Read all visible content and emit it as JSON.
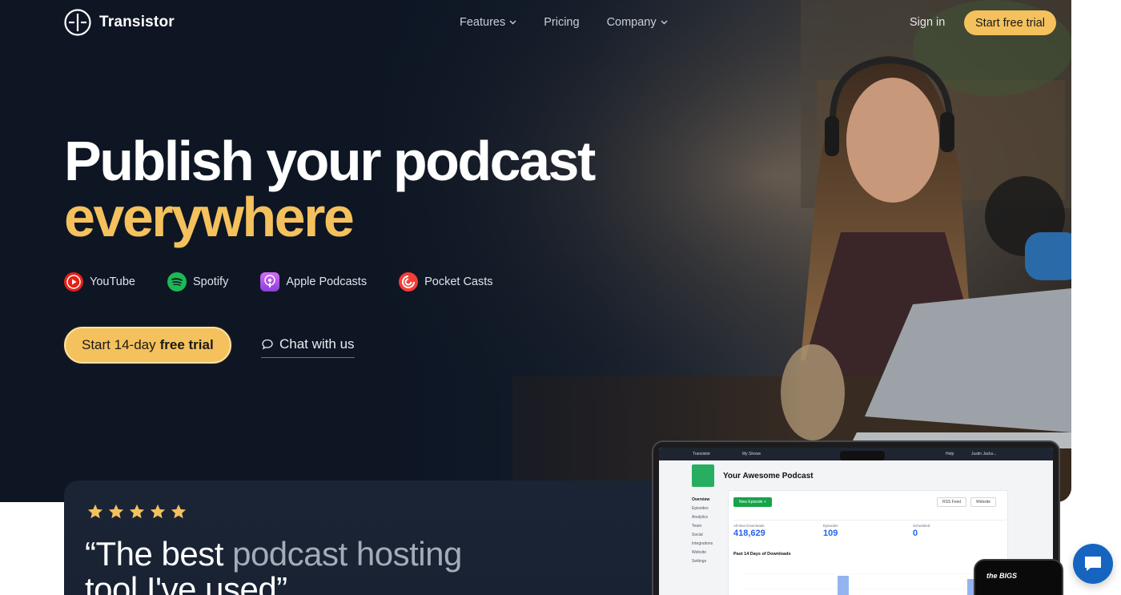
{
  "brand": {
    "name": "Transistor"
  },
  "nav": {
    "links": [
      {
        "label": "Features",
        "has_dropdown": true
      },
      {
        "label": "Pricing",
        "has_dropdown": false
      },
      {
        "label": "Company",
        "has_dropdown": true
      }
    ],
    "sign_in": "Sign in",
    "trial": "Start free trial"
  },
  "hero": {
    "headline_line1": "Publish your podcast",
    "headline_line2": "everywhere",
    "platforms": [
      {
        "label": "YouTube",
        "icon": "youtube-icon"
      },
      {
        "label": "Spotify",
        "icon": "spotify-icon"
      },
      {
        "label": "Apple Podcasts",
        "icon": "apple-podcasts-icon"
      },
      {
        "label": "Pocket Casts",
        "icon": "pocket-casts-icon"
      }
    ],
    "cta_prefix": "Start 14-day",
    "cta_bold": "free trial",
    "chat_label": "Chat with us"
  },
  "testimonial": {
    "rating": 5,
    "quote_line1_bright": "“The best ",
    "quote_line1_dim": "podcast hosting",
    "quote_line2": "tool I've used”"
  },
  "app_preview": {
    "topbar_brand": "Transistor",
    "topbar_shows": "My Shows",
    "topbar_help": "Help",
    "topbar_user": "Justin Jacks...",
    "title": "Your Awesome Podcast",
    "sidebar": [
      "Overview",
      "Episodes",
      "Analytics",
      "Team",
      "Social",
      "Integrations",
      "Website",
      "Settings"
    ],
    "new_episode": "New Episode +",
    "rss_feed": "RSS Feed",
    "website": "Website",
    "stats": [
      {
        "label": "All-time Downloads",
        "value": "418,629"
      },
      {
        "label": "Episodes",
        "value": "109"
      },
      {
        "label": "Scheduled",
        "value": "0"
      }
    ],
    "chart_label": "Past 14 Days of Downloads",
    "phone_text": "the BIGS"
  },
  "colors": {
    "accent": "#f4c15d",
    "hero_bg": "#0e1624",
    "chat_widget": "#1565c0"
  }
}
